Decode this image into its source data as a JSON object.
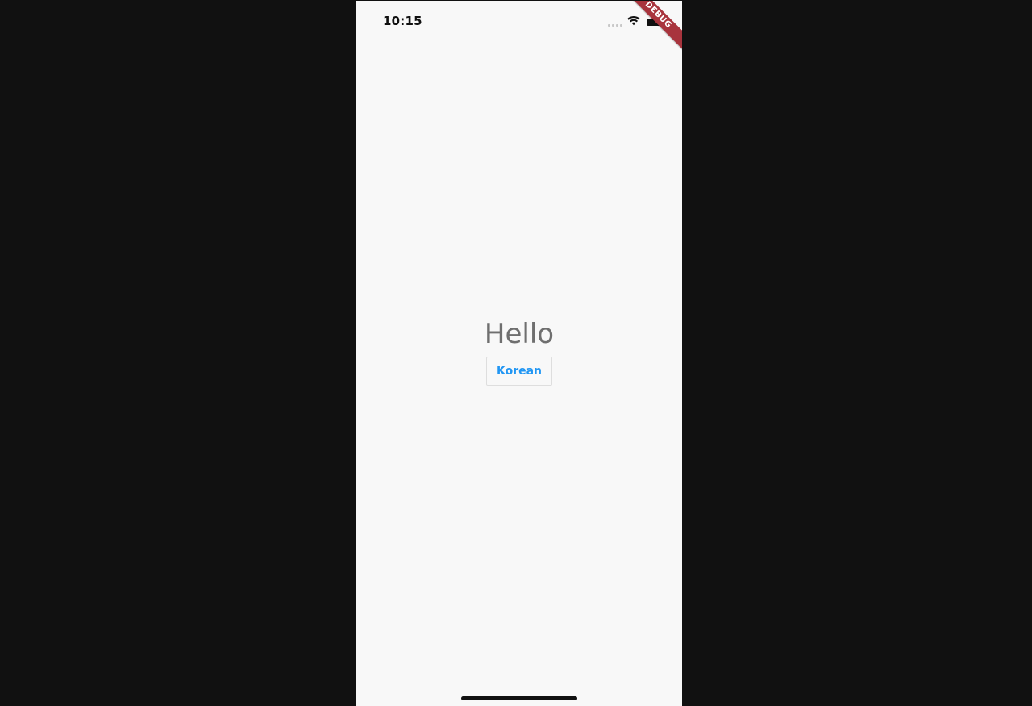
{
  "status_bar": {
    "time": "10:15",
    "icons": [
      "cellular-signal-icon",
      "wifi-icon",
      "battery-icon"
    ]
  },
  "debug_banner": {
    "label": "DEBUG",
    "color": "#a8343d"
  },
  "main": {
    "greeting": "Hello",
    "language_button_label": "Korean"
  },
  "colors": {
    "background": "#f8f8f8",
    "outer_background": "#111111",
    "greeting_text": "#6f6f6f",
    "button_text": "#2196f3",
    "button_border": "#dedede"
  }
}
